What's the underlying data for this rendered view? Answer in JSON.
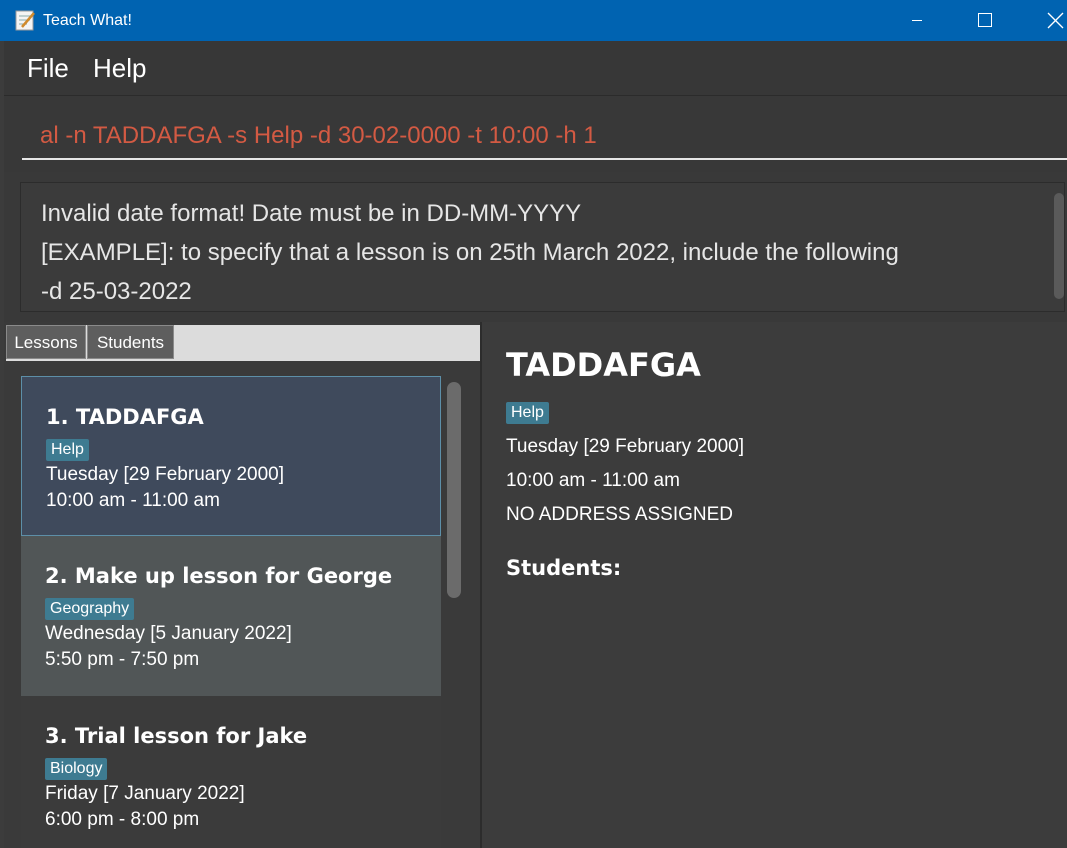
{
  "window": {
    "title": "Teach What!"
  },
  "menu": {
    "file": "File",
    "help": "Help"
  },
  "command": {
    "value": "al -n TADDAFGA -s Help -d 30-02-0000 -t 10:00 -h 1",
    "text_color": "#d35a43"
  },
  "result": {
    "lines": [
      "Invalid date format! Date must be in DD-MM-YYYY",
      "[EXAMPLE]: to specify that a lesson is on 25th March 2022, include the following",
      "-d 25-03-2022"
    ]
  },
  "tabs": {
    "lessons": "Lessons",
    "students": "Students"
  },
  "lessons": [
    {
      "title": "1.  TADDAFGA",
      "subject": "Help",
      "date": "Tuesday [29 February 2000]",
      "time": "10:00 am - 11:00 am"
    },
    {
      "title": "2.  Make up lesson for George",
      "subject": "Geography",
      "date": "Wednesday [5 January 2022]",
      "time": "5:50 pm - 7:50 pm"
    },
    {
      "title": "3.  Trial lesson for Jake",
      "subject": "Biology",
      "date": "Friday [7 January 2022]",
      "time": "6:00 pm - 8:00 pm"
    }
  ],
  "detail": {
    "title": "TADDAFGA",
    "subject": "Help",
    "date": "Tuesday [29 February 2000]",
    "time": "10:00 am - 11:00 am",
    "address": "NO ADDRESS ASSIGNED",
    "students_label": "Students:"
  },
  "colors": {
    "titlebar": "#0063b1",
    "tag": "#3e7b91",
    "selected_card": "#3f4a5c"
  },
  "icons": {
    "app": "notepad-icon",
    "minimize": "minimize-icon",
    "maximize": "maximize-icon",
    "close": "close-icon"
  }
}
